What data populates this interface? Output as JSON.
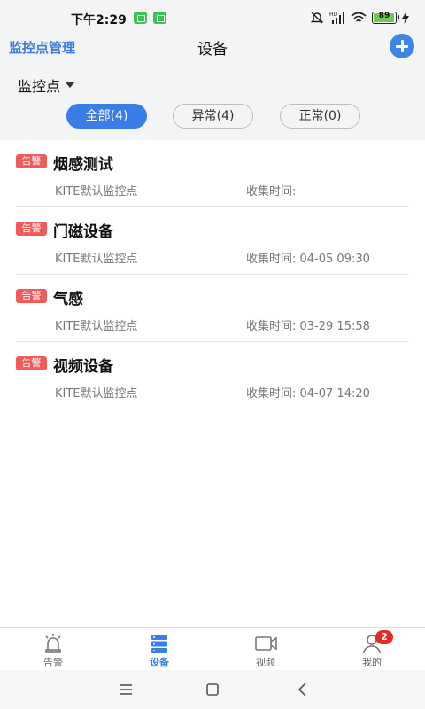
{
  "status_bar": {
    "time": "下午2:29",
    "battery": "89"
  },
  "header": {
    "back_label": "监控点管理",
    "title": "设备",
    "filter_select": "监控点"
  },
  "segments": [
    {
      "label": "全部(4)"
    },
    {
      "label": "异常(4)"
    },
    {
      "label": "正常(0)"
    }
  ],
  "devices": [
    {
      "badge": "告警",
      "name": "烟感测试",
      "point": "KITE默认监控点",
      "collect": "收集时间:"
    },
    {
      "badge": "告警",
      "name": "门磁设备",
      "point": "KITE默认监控点",
      "collect": "收集时间:  04-05 09:30"
    },
    {
      "badge": "告警",
      "name": "气感",
      "point": "KITE默认监控点",
      "collect": "收集时间:  03-29 15:58"
    },
    {
      "badge": "告警",
      "name": "视频设备",
      "point": "KITE默认监控点",
      "collect": "收集时间:  04-07 14:20"
    }
  ],
  "tabs": [
    {
      "label": "告警",
      "icon": "alarm-icon"
    },
    {
      "label": "设备",
      "icon": "device-server-icon"
    },
    {
      "label": "视频",
      "icon": "video-camera-icon"
    },
    {
      "label": "我的",
      "icon": "user-icon",
      "badge": "2"
    }
  ],
  "colors": {
    "accent": "#3b7de6",
    "alert_badge": "#ef5a5a",
    "notif_badge": "#e52a2a",
    "battery_fill": "#6ccc52"
  }
}
